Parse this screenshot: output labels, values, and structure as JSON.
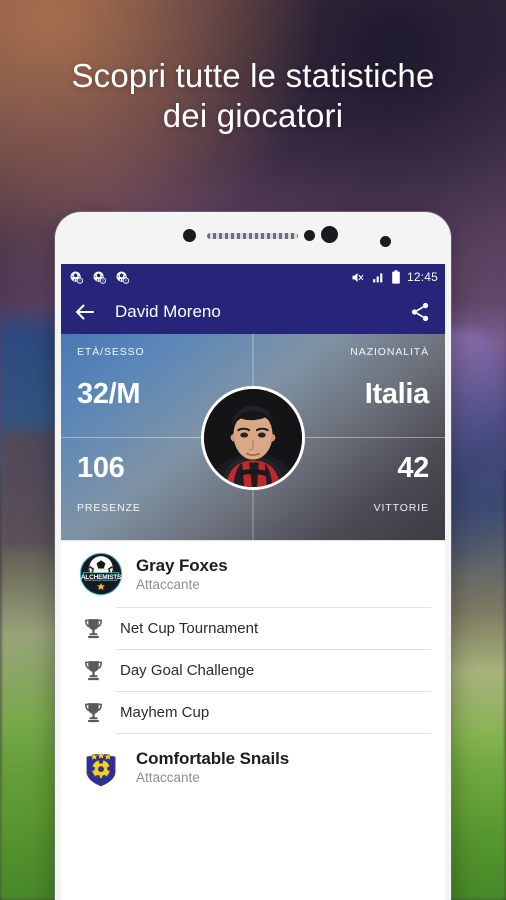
{
  "headline": {
    "line1": "Scopri tutte le statistiche",
    "line2": "dei giocatori"
  },
  "colors": {
    "status_bar": "#27257a",
    "app_bar": "#27257a",
    "hero_gradient_start": "#4a78b4",
    "hero_gradient_end": "#3c3c44",
    "crest_snails_shield": "#2f3191",
    "crest_snails_ball": "#f5cf1e",
    "jersey_red": "#c2292c"
  },
  "status_bar": {
    "notification_icons": [
      "soccer-ball-notification-icon",
      "soccer-ball-notification-icon",
      "soccer-ball-notification-icon"
    ],
    "mute_icon": "volume-muted-icon",
    "signal_icon": "signal-bars-icon",
    "battery_icon": "battery-icon",
    "time": "12:45"
  },
  "app_bar": {
    "back_icon": "back-arrow-icon",
    "title": "David Moreno",
    "share_icon": "share-icon"
  },
  "hero": {
    "age_sex_label": "ETÀ/SESSO",
    "age_sex_value": "32/M",
    "nationality_label": "NAZIONALITÀ",
    "nationality_value": "Italia",
    "appearances_value": "106",
    "appearances_label": "PRESENZE",
    "wins_value": "42",
    "wins_label": "VITTORIE",
    "avatar": "player-avatar"
  },
  "teams": [
    {
      "crest": "alchemists-crest-icon",
      "name": "Gray Foxes",
      "role": "Attaccante",
      "tournaments": [
        {
          "icon": "trophy-icon",
          "label": "Net Cup Tournament"
        },
        {
          "icon": "trophy-icon",
          "label": "Day Goal Challenge"
        },
        {
          "icon": "trophy-icon",
          "label": "Mayhem Cup"
        }
      ]
    },
    {
      "crest": "snails-crest-icon",
      "name": "Comfortable Snails",
      "role": "Attaccante",
      "tournaments": []
    }
  ]
}
